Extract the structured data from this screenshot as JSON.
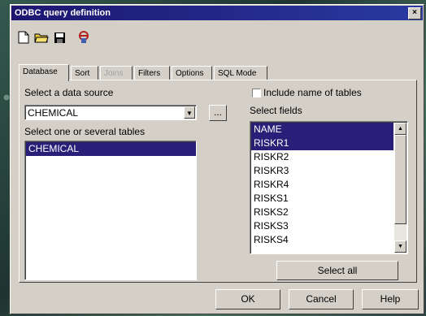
{
  "window": {
    "title": "ODBC query definition",
    "close_glyph": "×"
  },
  "toolbar": {
    "icons": [
      "new-document-icon",
      "open-folder-icon",
      "save-disk-icon",
      "odbc-connect-icon"
    ]
  },
  "tabs": [
    {
      "label": "Database",
      "state": "active"
    },
    {
      "label": "Sort",
      "state": "normal"
    },
    {
      "label": "Joins",
      "state": "disabled"
    },
    {
      "label": "Filters",
      "state": "normal"
    },
    {
      "label": "Options",
      "state": "normal"
    },
    {
      "label": "SQL Mode",
      "state": "normal"
    }
  ],
  "datasource": {
    "label": "Select a data source",
    "value": "CHEMICAL",
    "browse_label": "..."
  },
  "tables": {
    "label": "Select one or several tables",
    "items": [
      {
        "text": "CHEMICAL",
        "selected": true
      }
    ]
  },
  "include_names": {
    "label": "Include name of tables",
    "checked": false
  },
  "fields": {
    "label": "Select fields",
    "items": [
      {
        "text": "NAME",
        "selected": true
      },
      {
        "text": "RISKR1",
        "selected": true
      },
      {
        "text": "RISKR2",
        "selected": false
      },
      {
        "text": "RISKR3",
        "selected": false
      },
      {
        "text": "RISKR4",
        "selected": false
      },
      {
        "text": "RISKS1",
        "selected": false
      },
      {
        "text": "RISKS2",
        "selected": false
      },
      {
        "text": "RISKS3",
        "selected": false
      },
      {
        "text": "RISKS4",
        "selected": false
      }
    ],
    "select_all_label": "Select all"
  },
  "buttons": {
    "ok": "OK",
    "cancel": "Cancel",
    "help": "Help"
  },
  "colors": {
    "selection": "#2a1f78",
    "titlebar": "#1c1670",
    "face": "#d4d0c8"
  }
}
